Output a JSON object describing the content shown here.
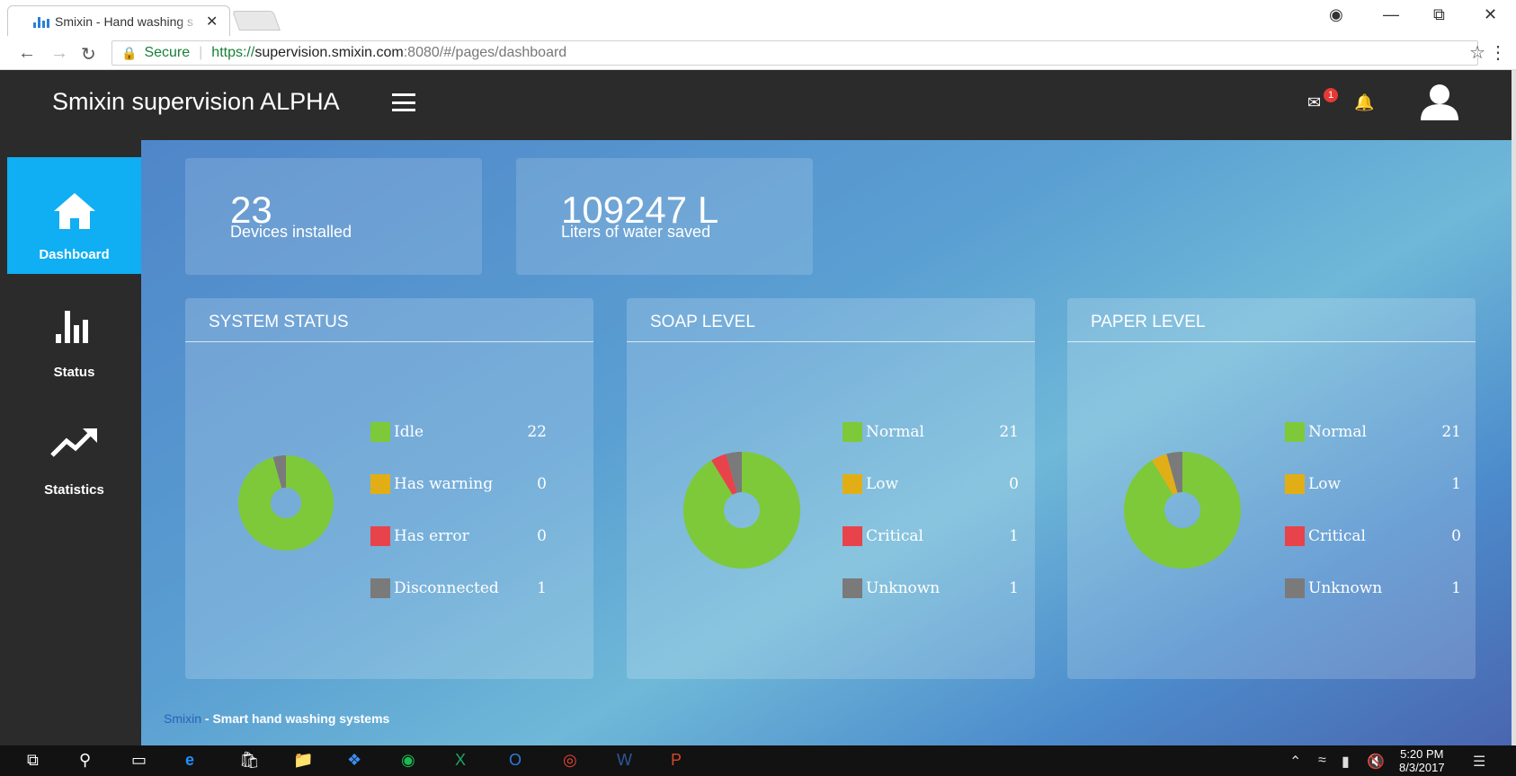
{
  "browser": {
    "tab_title": "Smixin - Hand washing s",
    "secure_label": "Secure",
    "url_https": "https://",
    "url_host": "supervision.smixin.com",
    "url_path": ":8080/#/pages/dashboard"
  },
  "app": {
    "title": "Smixin supervision ALPHA",
    "mail_badge": "1"
  },
  "sidebar": {
    "items": [
      {
        "label": "Dashboard",
        "icon": "home-icon",
        "active": true
      },
      {
        "label": "Status",
        "icon": "bar-chart-icon",
        "active": false
      },
      {
        "label": "Statistics",
        "icon": "trend-up-icon",
        "active": false
      }
    ]
  },
  "kpis": [
    {
      "value": "23",
      "caption": "Devices installed"
    },
    {
      "value": "109247 L",
      "caption": "Liters of water saved"
    }
  ],
  "colors": {
    "green": "#7dc93a",
    "yellow": "#e2ae16",
    "red": "#e8434a",
    "gray": "#7a7a7a"
  },
  "chart_data": [
    {
      "type": "pie",
      "title": "SYSTEM STATUS",
      "categories": [
        "Idle",
        "Has warning",
        "Has error",
        "Disconnected"
      ],
      "values": [
        22,
        0,
        0,
        1
      ],
      "colors": [
        "#7dc93a",
        "#e2ae16",
        "#e8434a",
        "#7a7a7a"
      ]
    },
    {
      "type": "pie",
      "title": "SOAP LEVEL",
      "categories": [
        "Normal",
        "Low",
        "Critical",
        "Unknown"
      ],
      "values": [
        21,
        0,
        1,
        1
      ],
      "colors": [
        "#7dc93a",
        "#e2ae16",
        "#e8434a",
        "#7a7a7a"
      ]
    },
    {
      "type": "pie",
      "title": "PAPER LEVEL",
      "categories": [
        "Normal",
        "Low",
        "Critical",
        "Unknown"
      ],
      "values": [
        21,
        1,
        0,
        1
      ],
      "colors": [
        "#7dc93a",
        "#e2ae16",
        "#e8434a",
        "#7a7a7a"
      ]
    }
  ],
  "footer": {
    "brand": "Smixin",
    "text": " - Smart hand washing systems"
  },
  "taskbar": {
    "time": "5:20 PM",
    "date": "8/3/2017"
  }
}
